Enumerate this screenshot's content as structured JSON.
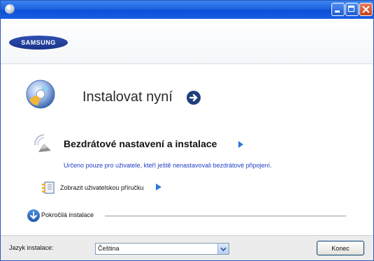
{
  "header": {
    "brand": "SAMSUNG"
  },
  "main": {
    "install_title": "Instalovat nyní",
    "wireless_title": "Bezdrátové nastavení a instalace",
    "wireless_note": "Určeno pouze pro uživatele, kteří ještě nenastavovali bezdrátové připojení.",
    "manual_label": "Zobrazit uživatelskou příručku",
    "advanced_label": "Pokročilá instalace"
  },
  "footer": {
    "language_label": "Jazyk instalace:",
    "language_value": "Čeština",
    "finish_label": "Konec"
  },
  "colors": {
    "title_bar": "#1d61e0",
    "accent_arrow": "#2e78d8",
    "note_text": "#1f3fc8",
    "close_button": "#c6401e"
  }
}
